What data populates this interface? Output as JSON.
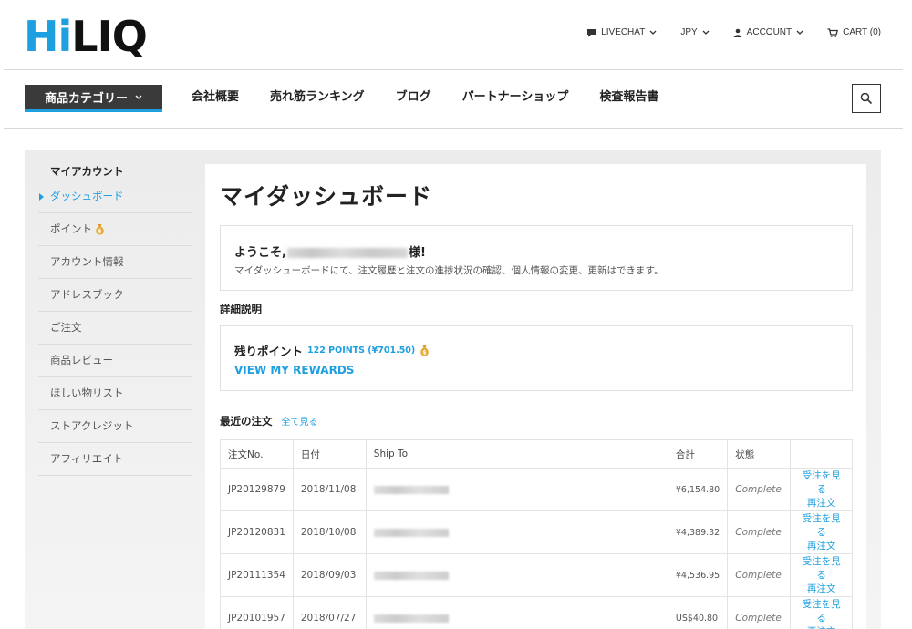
{
  "logo": {
    "part1": "Hi",
    "part2": "LIQ"
  },
  "topnav": {
    "livechat": "LIVECHAT",
    "currency": "JPY",
    "account": "ACCOUNT",
    "cart": "CART (0)"
  },
  "mainnav": {
    "category_button": "商品カテゴリー",
    "items": [
      "会社概要",
      "売れ筋ランキング",
      "ブログ",
      "パートナーショップ",
      "検査報告書"
    ]
  },
  "sidebar": {
    "heading": "マイアカウント",
    "items": [
      "ダッシュボード",
      "ポイント",
      "アカウント情報",
      "アドレスブック",
      "ご注文",
      "商品レビュー",
      "ほしい物リスト",
      "ストアクレジット",
      "アフィリエイト"
    ]
  },
  "main": {
    "title": "マイダッシュボード",
    "welcome_prefix": "ようこそ,",
    "welcome_suffix": "様!",
    "welcome_text": "マイダッシューボードにて、注文履歴と注文の進捗状況の確認、個人情報の変更、更新はできます。",
    "details_heading": "詳細説明",
    "points_label": "残りポイント",
    "points_value": "122 POINTS (¥701.50)",
    "rewards_link": "VIEW MY REWARDS",
    "orders_heading": "最近の注文",
    "view_all": "全て見る"
  },
  "orders": {
    "columns": [
      "注文No.",
      "日付",
      "Ship To",
      "合計",
      "状態",
      ""
    ],
    "view_label": "受注を見る",
    "reorder_label": "再注文",
    "rows": [
      {
        "no": "JP20129879",
        "date": "2018/11/08",
        "total": "¥6,154.80",
        "status": "Complete"
      },
      {
        "no": "JP20120831",
        "date": "2018/10/08",
        "total": "¥4,389.32",
        "status": "Complete"
      },
      {
        "no": "JP20111354",
        "date": "2018/09/03",
        "total": "¥4,536.95",
        "status": "Complete"
      },
      {
        "no": "JP20101957",
        "date": "2018/07/27",
        "total": "US$40.80",
        "status": "Complete"
      }
    ]
  },
  "colors": {
    "accent": "#1e9fe0",
    "nav_dark": "#3a3a3a"
  },
  "icons": [
    "chat-icon",
    "chevron-down-icon",
    "user-icon",
    "cart-icon",
    "search-icon",
    "money-bag-icon"
  ]
}
